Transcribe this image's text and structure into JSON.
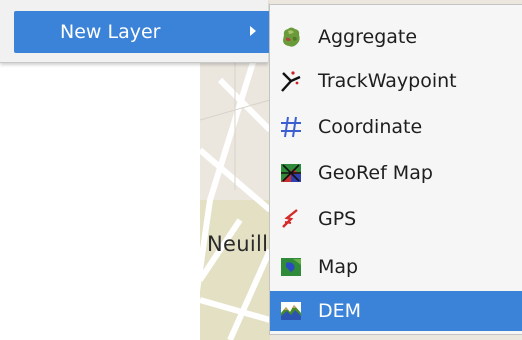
{
  "menu": {
    "parent_item": {
      "label": "New Layer",
      "icon": "arrow-right-icon"
    }
  },
  "submenu": {
    "items": [
      {
        "label": "Aggregate",
        "icon": "aggregate-icon"
      },
      {
        "label": "TrackWaypoint",
        "icon": "track-waypoint-icon"
      },
      {
        "label": "Coordinate",
        "icon": "coordinate-grid-icon"
      },
      {
        "label": "GeoRef Map",
        "icon": "georef-map-icon"
      },
      {
        "label": "GPS",
        "icon": "gps-icon"
      },
      {
        "label": "Map",
        "icon": "map-icon"
      },
      {
        "label": "DEM",
        "icon": "dem-icon",
        "selected": true
      }
    ]
  },
  "map": {
    "visible_text": "Neuill"
  },
  "colors": {
    "highlight": "#3b83d8",
    "menu_bg": "#f6f6f6"
  }
}
